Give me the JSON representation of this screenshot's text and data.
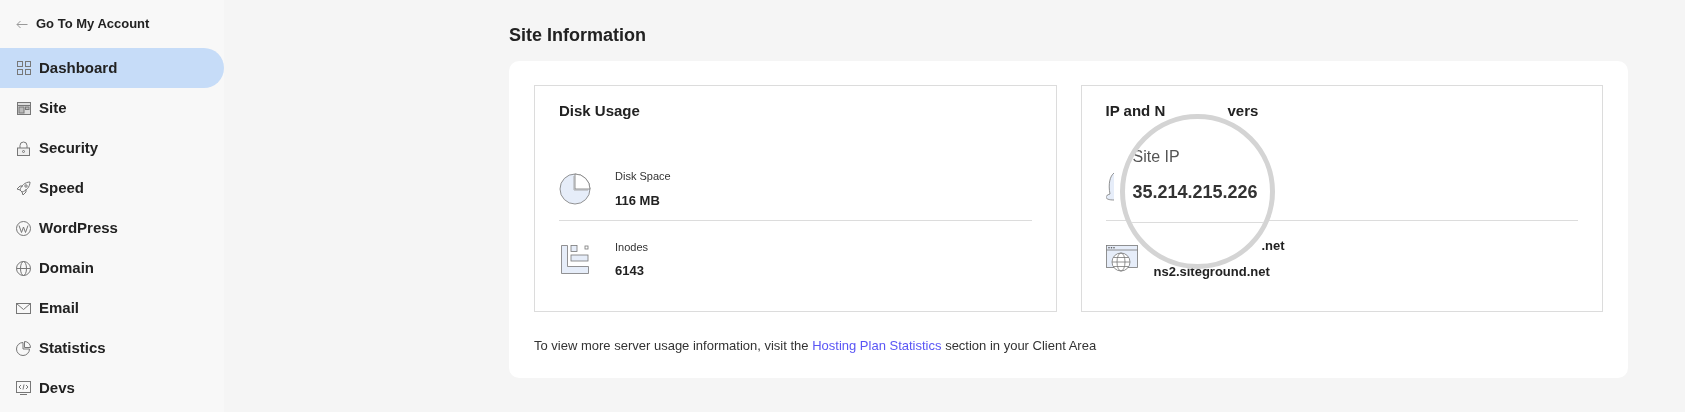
{
  "sidebar": {
    "back_link": "Go To My Account",
    "items": [
      {
        "label": "Dashboard",
        "selected": true
      },
      {
        "label": "Site",
        "selected": false
      },
      {
        "label": "Security",
        "selected": false
      },
      {
        "label": "Speed",
        "selected": false
      },
      {
        "label": "WordPress",
        "selected": false
      },
      {
        "label": "Domain",
        "selected": false
      },
      {
        "label": "Email",
        "selected": false
      },
      {
        "label": "Statistics",
        "selected": false
      },
      {
        "label": "Devs",
        "selected": false
      }
    ]
  },
  "page_title": "Site Information",
  "disk_usage": {
    "title": "Disk Usage",
    "rows": [
      {
        "kind": "pie",
        "label": "Disk Space",
        "value": "116 MB"
      },
      {
        "kind": "inodes",
        "label": "Inodes",
        "value": "6143"
      }
    ]
  },
  "ip_servers": {
    "title_visible_start": "IP and N",
    "title_visible_end": "vers",
    "ns_visible": [
      ".net",
      "ns2.siteground.net"
    ],
    "magnifier": {
      "label": "Site IP",
      "value": "35.214.215.226"
    }
  },
  "footer": {
    "before": "To view more server usage information, visit the ",
    "link": "Hosting Plan Statistics",
    "after": " section in your Client Area"
  }
}
